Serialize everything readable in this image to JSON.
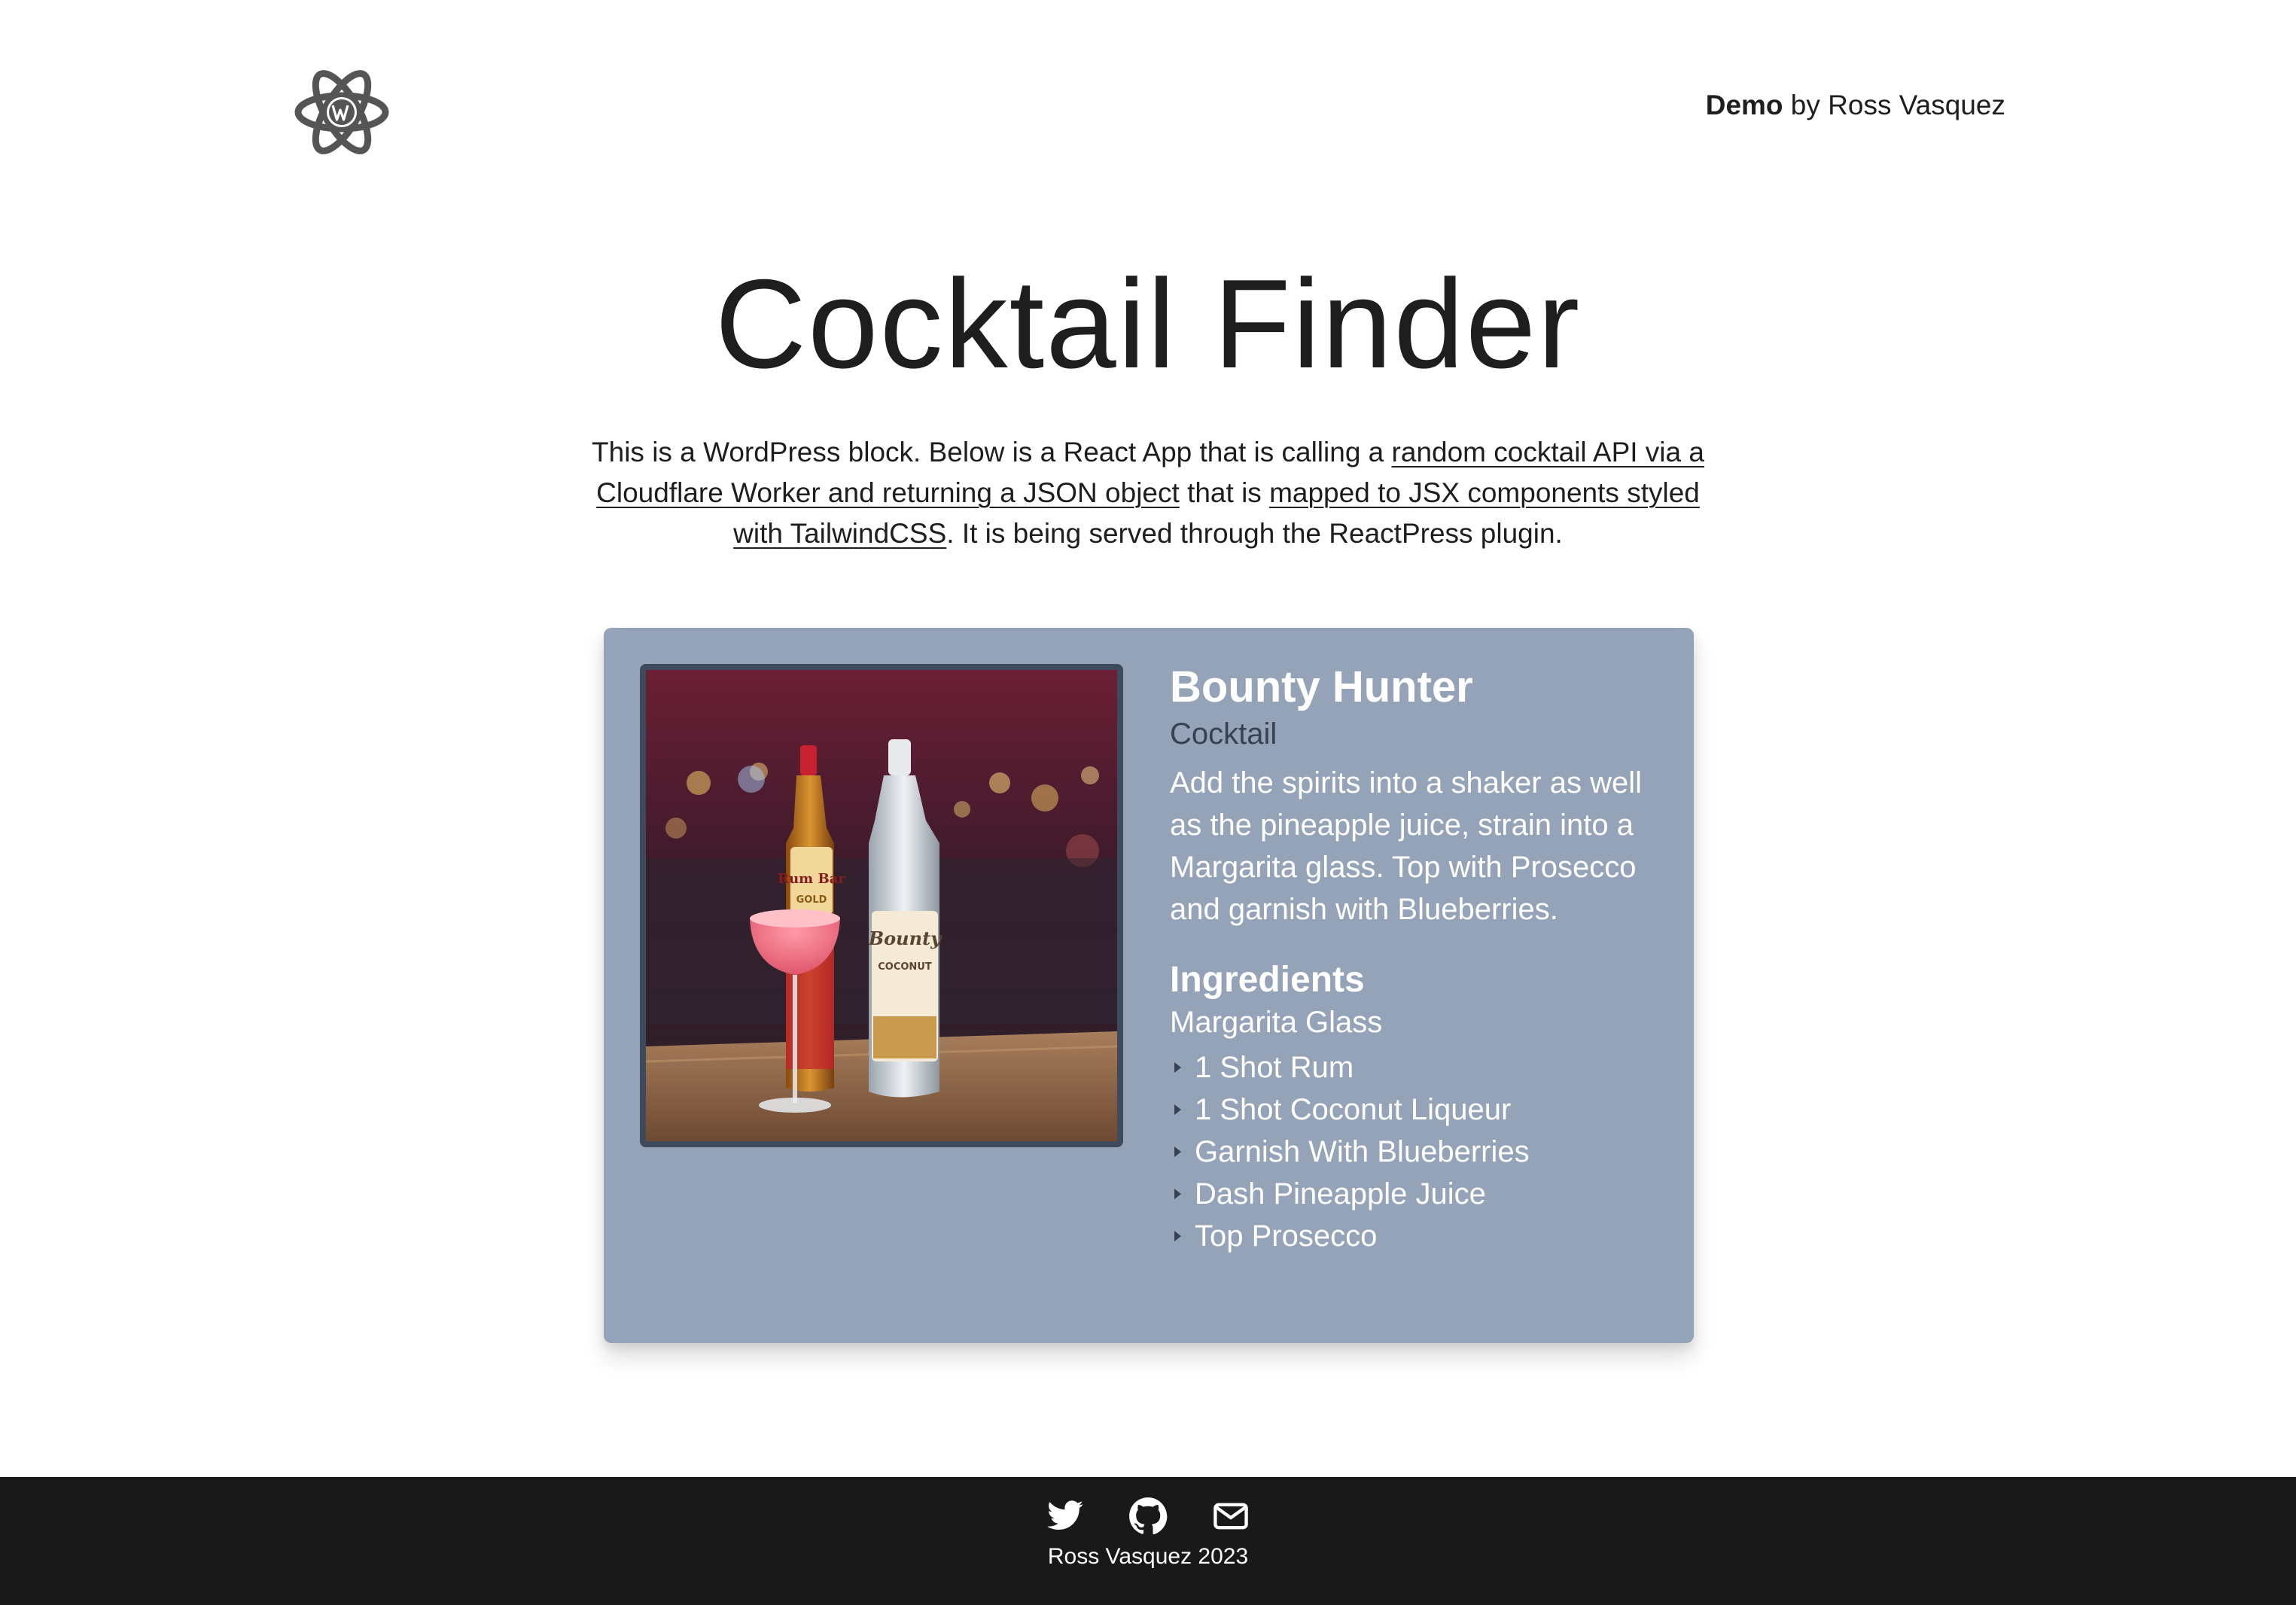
{
  "header": {
    "brand_bold": "Demo",
    "brand_rest": " by Ross Vasquez",
    "logo_icon": "wordpress-react-logo-icon"
  },
  "page": {
    "title": "Cocktail Finder"
  },
  "intro": {
    "text_1": "This is a WordPress block. Below is a React App that is calling a ",
    "link_1": "random cocktail API via a Cloudflare Worker and returning a JSON object",
    "text_2": " that is ",
    "link_2": "mapped to JSX components styled with TailwindCSS",
    "text_3": ". It is being served through the ReactPress plugin."
  },
  "cocktail": {
    "name": "Bounty Hunter",
    "category": "Cocktail",
    "instructions": "Add the spirits into a shaker as well as the pineapple juice, strain into a Margarita glass. Top with Prosecco and garnish with Blueberries.",
    "ingredients_heading": "Ingredients",
    "glass": "Margarita Glass",
    "ingredients": [
      "1 Shot Rum",
      "1 Shot Coconut Liqueur",
      "Garnish With Blueberries",
      "Dash Pineapple Juice",
      "Top Prosecco"
    ],
    "photo_bottle_1_label": "Rum Bar",
    "photo_bottle_1_sub": "GOLD",
    "photo_bottle_2_label": "Bounty",
    "photo_bottle_2_sub": "COCONUT"
  },
  "colors": {
    "card_bg": "#94a3b8",
    "footer_bg": "#191919",
    "muted_text": "#374151"
  },
  "footer": {
    "icons": [
      "twitter-icon",
      "github-icon",
      "mail-icon"
    ],
    "credit": "Ross Vasquez 2023"
  }
}
